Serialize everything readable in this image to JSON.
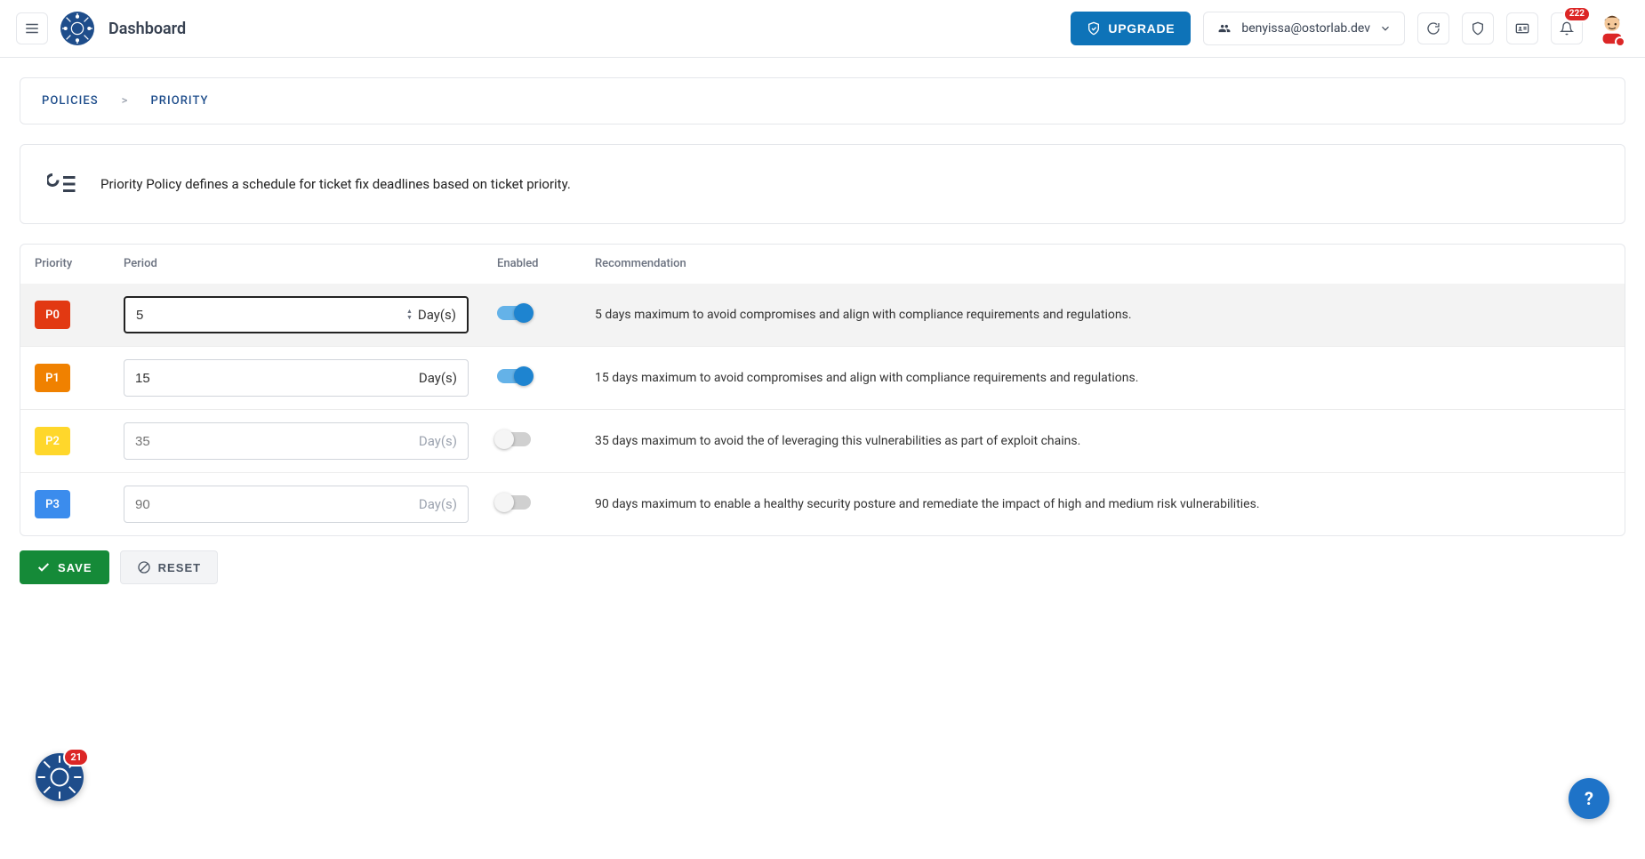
{
  "header": {
    "title": "Dashboard",
    "upgrade_label": "UPGRADE",
    "user_email": "benyissa@ostorlab.dev",
    "notification_count": "222"
  },
  "breadcrumb": {
    "item0": "POLICIES",
    "item1": "PRIORITY"
  },
  "info": {
    "text": "Priority Policy defines a schedule for ticket fix deadlines based on ticket priority."
  },
  "table": {
    "headers": {
      "priority": "Priority",
      "period": "Period",
      "enabled": "Enabled",
      "recommendation": "Recommendation"
    },
    "unit": "Day(s)",
    "rows": [
      {
        "chip": "P0",
        "chip_class": "p0",
        "value": "5",
        "enabled": true,
        "focused": true,
        "rec": "5 days maximum to avoid compromises and align with compliance requirements and regulations."
      },
      {
        "chip": "P1",
        "chip_class": "p1",
        "value": "15",
        "enabled": true,
        "focused": false,
        "rec": "15 days maximum to avoid compromises and align with compliance requirements and regulations."
      },
      {
        "chip": "P2",
        "chip_class": "p2",
        "value": "35",
        "enabled": false,
        "focused": false,
        "rec": "35 days maximum to avoid the of leveraging this vulnerabilities as part of exploit chains."
      },
      {
        "chip": "P3",
        "chip_class": "p3",
        "value": "90",
        "enabled": false,
        "focused": false,
        "rec": "90 days maximum to enable a healthy security posture and remediate the impact of high and medium risk vulnerabilities."
      }
    ]
  },
  "actions": {
    "save": "SAVE",
    "reset": "RESET"
  },
  "float": {
    "count": "21"
  }
}
